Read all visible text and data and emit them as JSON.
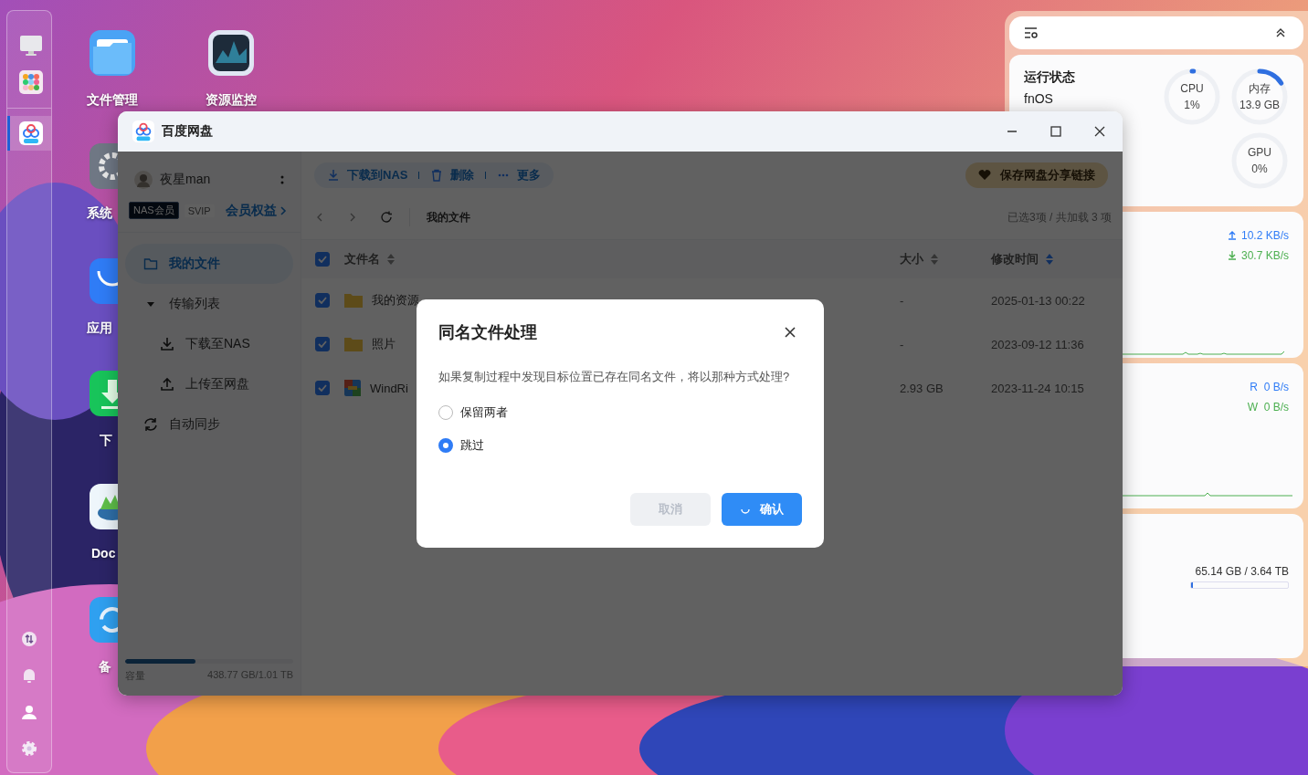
{
  "dock": [
    {
      "kind": "monitor",
      "selected": false
    },
    {
      "kind": "apps",
      "selected": false
    },
    {
      "kind": "cloud",
      "selected": true
    }
  ],
  "desktop_icons": [
    {
      "kind": "files",
      "label": "文件管理"
    },
    {
      "kind": "monitor",
      "label": "资源监控"
    },
    {
      "kind": "settings",
      "label": "系统"
    },
    {
      "kind": "store",
      "label": "应用"
    },
    {
      "kind": "download",
      "label": "下"
    },
    {
      "kind": "docker",
      "label": "Doc"
    },
    {
      "kind": "backup",
      "label": "备"
    }
  ],
  "widgets": {
    "status": {
      "title": "运行状态",
      "os": "fnOS",
      "gauges": [
        {
          "label": "CPU",
          "value": "1%",
          "level": 0.01
        },
        {
          "label": "内存",
          "value": "13.9 GB",
          "level": 0.16
        },
        {
          "label": "GPU",
          "value": "0%",
          "level": 0
        }
      ]
    },
    "network": {
      "upload": "10.2 KB/s",
      "download": "30.7 KB/s"
    },
    "disk_io": {
      "read": "R  0 B/s",
      "write": "W  0 B/s"
    },
    "storage": {
      "usage": "65.14 GB / 3.64 TB",
      "level": 0.02
    }
  },
  "window": {
    "title": "百度网盘",
    "user": {
      "name": "夜星man",
      "badges": [
        {
          "label": "NAS会员",
          "active": true
        },
        {
          "label": "SVIP",
          "active": false
        }
      ],
      "benefits": "会员权益"
    },
    "nav": [
      {
        "label": "我的文件",
        "kind": "folder",
        "selected": true
      },
      {
        "label": "传输列表",
        "kind": "group",
        "selected": false,
        "expanded": true,
        "children": [
          {
            "label": "下载至NAS",
            "kind": "download",
            "selected": false
          },
          {
            "label": "上传至网盘",
            "kind": "upload",
            "selected": false
          }
        ]
      },
      {
        "label": "自动同步",
        "kind": "sync",
        "selected": false
      }
    ],
    "capacity": {
      "label": "容量",
      "value": "438.77 GB/1.01 TB",
      "level": 0.42
    },
    "toolbar": [
      {
        "kind": "download",
        "label": "下载到NAS"
      },
      {
        "kind": "delete",
        "label": "删除"
      },
      {
        "kind": "more",
        "label": "更多"
      }
    ],
    "save_link": "保存网盘分享链接",
    "breadcrumb": "我的文件",
    "selection_info": "已选3项 / 共加载 3 项",
    "table": {
      "all_checked": true,
      "columns": [
        "文件名",
        "大小",
        "修改时间"
      ],
      "rows": [
        {
          "checked": true,
          "kind": "folder",
          "name": "我的资源",
          "size": "-",
          "modified": "2025-01-13 00:22"
        },
        {
          "checked": true,
          "kind": "folder",
          "name": "照片",
          "size": "-",
          "modified": "2023-09-12 11:36"
        },
        {
          "checked": true,
          "kind": "archive",
          "name": "WindRi",
          "size": "2.93 GB",
          "modified": "2023-11-24 10:15"
        }
      ]
    }
  },
  "dialog": {
    "title": "同名文件处理",
    "message": "如果复制过程中发现目标位置已存在同名文件，将以那种方式处理?",
    "options": [
      {
        "label": "保留两者",
        "selected": false
      },
      {
        "label": "跳过",
        "selected": true
      }
    ],
    "cancel": {
      "label": "取消",
      "disabled": true
    },
    "confirm": {
      "label": "确认",
      "loading": true
    }
  }
}
